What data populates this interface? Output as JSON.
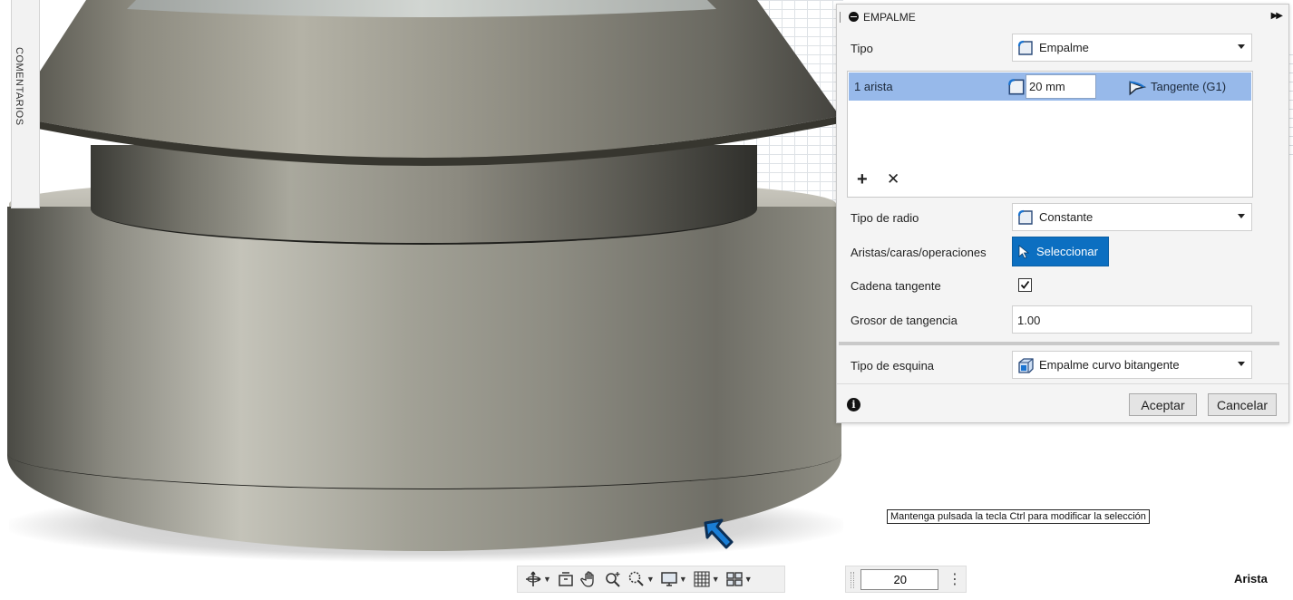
{
  "viewport": {
    "comments_label": "COMENTARIOS",
    "tooltip": "Mantenga pulsada la tecla Ctrl para modificar la selección"
  },
  "dialog": {
    "title": "EMPALME",
    "type_label": "Tipo",
    "type_value": "Empalme",
    "edges": [
      {
        "name": "1 arista",
        "radius": "20 mm",
        "continuity": "Tangente (G1)"
      }
    ],
    "radius_type_label": "Tipo de radio",
    "radius_type_value": "Constante",
    "selection_label": "Aristas/caras/operaciones",
    "select_button": "Seleccionar",
    "tangent_chain_label": "Cadena tangente",
    "tangent_chain_checked": true,
    "tangency_weight_label": "Grosor de tangencia",
    "tangency_weight_value": "1.00",
    "corner_type_label": "Tipo de esquina",
    "corner_type_value": "Empalme curvo bitangente",
    "ok_button": "Aceptar",
    "cancel_button": "Cancelar",
    "info_symbol": "i"
  },
  "bottom_bar": {
    "value_input": "20",
    "status": "Arista"
  },
  "colors": {
    "selected_row": "#97b9ea",
    "select_button": "#0c6fc1",
    "dialog_bg": "#f4f4f4"
  }
}
